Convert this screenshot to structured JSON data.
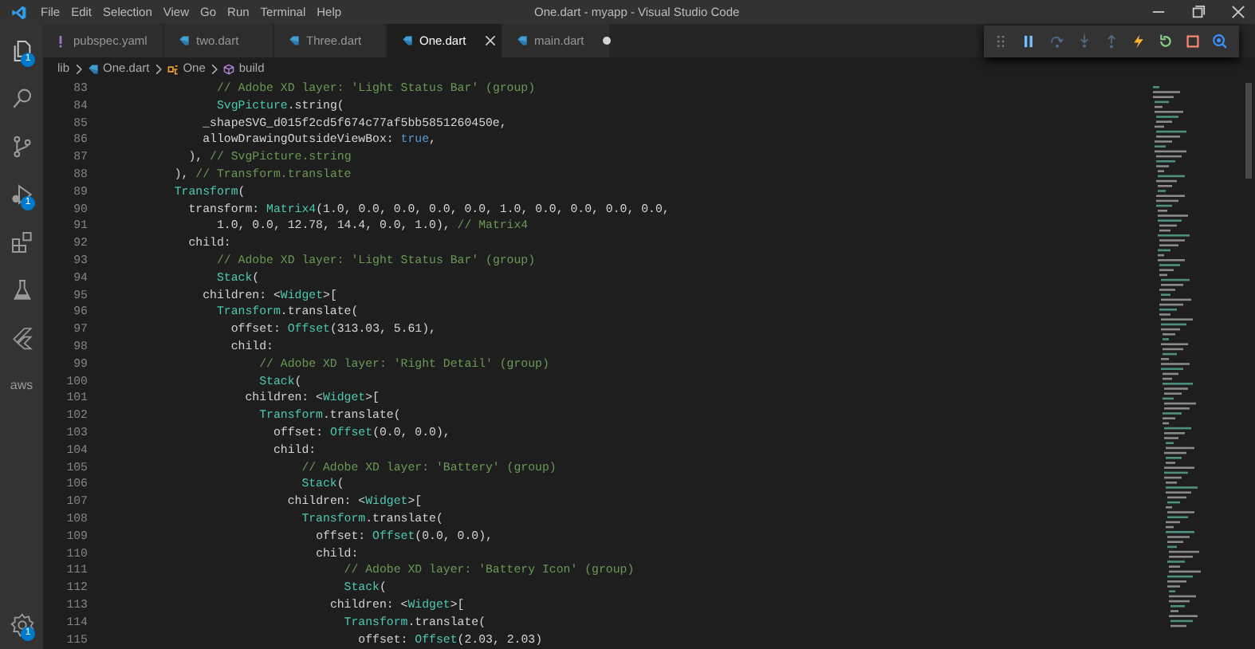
{
  "title_bar": {
    "menu": [
      "File",
      "Edit",
      "Selection",
      "View",
      "Go",
      "Run",
      "Terminal",
      "Help"
    ],
    "title": "One.dart - myapp - Visual Studio Code"
  },
  "activity_bar": {
    "items": [
      {
        "kind": "explorer",
        "badge": "1"
      },
      {
        "kind": "search"
      },
      {
        "kind": "source-control"
      },
      {
        "kind": "run-debug",
        "badge": "1"
      },
      {
        "kind": "extensions"
      },
      {
        "kind": "testing"
      },
      {
        "kind": "flutter"
      },
      {
        "kind": "aws",
        "label": "aws"
      }
    ],
    "bottom": {
      "kind": "settings",
      "badge": "1"
    }
  },
  "tabs": [
    {
      "label": "pubspec.yaml",
      "kind": "yaml",
      "selected": false,
      "modified": false
    },
    {
      "label": "two.dart",
      "kind": "dart",
      "selected": false,
      "modified": false
    },
    {
      "label": "Three.dart",
      "kind": "dart",
      "selected": false,
      "modified": false
    },
    {
      "label": "One.dart",
      "kind": "dart",
      "selected": true,
      "modified": false
    },
    {
      "label": "main.dart",
      "kind": "dart",
      "selected": false,
      "modified": true
    }
  ],
  "breadcrumbs": [
    {
      "kind": "folder",
      "label": "lib"
    },
    {
      "kind": "dart",
      "label": "One.dart"
    },
    {
      "kind": "class",
      "label": "One"
    },
    {
      "kind": "method",
      "label": "build"
    }
  ],
  "debug_toolbar": [
    {
      "kind": "grip"
    },
    {
      "kind": "pause"
    },
    {
      "kind": "step-over"
    },
    {
      "kind": "step-into"
    },
    {
      "kind": "step-out"
    },
    {
      "kind": "hot-reload"
    },
    {
      "kind": "restart"
    },
    {
      "kind": "stop"
    },
    {
      "kind": "devtools"
    }
  ],
  "editor": {
    "lines": [
      {
        "number": "83",
        "segments": [
          {
            "kind": "comment",
            "text": "                // Adobe XD layer: 'Light Status Bar' (group)"
          }
        ]
      },
      {
        "number": "84",
        "segments": [
          {
            "kind": "type",
            "text": "                SvgPicture"
          },
          {
            "kind": "plain",
            "text": ".string("
          }
        ]
      },
      {
        "number": "85",
        "segments": [
          {
            "kind": "plain",
            "text": "              _shapeSVG_d015f2cd5f674c77af5bb5851260450e,"
          }
        ]
      },
      {
        "number": "86",
        "segments": [
          {
            "kind": "plain",
            "text": "              allowDrawingOutsideViewBox: "
          },
          {
            "kind": "keyword",
            "text": "true"
          },
          {
            "kind": "plain",
            "text": ","
          }
        ]
      },
      {
        "number": "87",
        "segments": [
          {
            "kind": "plain",
            "text": "            ), "
          },
          {
            "kind": "comment",
            "text": "// SvgPicture.string"
          }
        ]
      },
      {
        "number": "88",
        "segments": [
          {
            "kind": "plain",
            "text": "          ), "
          },
          {
            "kind": "comment",
            "text": "// Transform.translate"
          }
        ]
      },
      {
        "number": "89",
        "segments": [
          {
            "kind": "type",
            "text": "          Transform"
          },
          {
            "kind": "plain",
            "text": "("
          }
        ]
      },
      {
        "number": "90",
        "segments": [
          {
            "kind": "plain",
            "text": "            transform: "
          },
          {
            "kind": "type",
            "text": "Matrix4"
          },
          {
            "kind": "plain",
            "text": "(1.0, 0.0, 0.0, 0.0, 0.0, 1.0, 0.0, 0.0, 0.0, 0.0,"
          }
        ]
      },
      {
        "number": "91",
        "segments": [
          {
            "kind": "plain",
            "text": "                1.0, 0.0, 12.78, 14.4, 0.0, 1.0), "
          },
          {
            "kind": "comment",
            "text": "// Matrix4"
          }
        ]
      },
      {
        "number": "92",
        "segments": [
          {
            "kind": "plain",
            "text": "            child:"
          }
        ]
      },
      {
        "number": "93",
        "segments": [
          {
            "kind": "comment",
            "text": "                // Adobe XD layer: 'Light Status Bar' (group)"
          }
        ]
      },
      {
        "number": "94",
        "segments": [
          {
            "kind": "type",
            "text": "                Stack"
          },
          {
            "kind": "plain",
            "text": "("
          }
        ]
      },
      {
        "number": "95",
        "segments": [
          {
            "kind": "plain",
            "text": "              children: <"
          },
          {
            "kind": "type",
            "text": "Widget"
          },
          {
            "kind": "plain",
            "text": ">["
          }
        ]
      },
      {
        "number": "96",
        "segments": [
          {
            "kind": "type",
            "text": "                Transform"
          },
          {
            "kind": "plain",
            "text": ".translate("
          }
        ]
      },
      {
        "number": "97",
        "segments": [
          {
            "kind": "plain",
            "text": "                  offset: "
          },
          {
            "kind": "type",
            "text": "Offset"
          },
          {
            "kind": "plain",
            "text": "(313.03, 5.61),"
          }
        ]
      },
      {
        "number": "98",
        "segments": [
          {
            "kind": "plain",
            "text": "                  child:"
          }
        ]
      },
      {
        "number": "99",
        "segments": [
          {
            "kind": "comment",
            "text": "                      // Adobe XD layer: 'Right Detail' (group)"
          }
        ]
      },
      {
        "number": "100",
        "segments": [
          {
            "kind": "type",
            "text": "                      Stack"
          },
          {
            "kind": "plain",
            "text": "("
          }
        ]
      },
      {
        "number": "101",
        "segments": [
          {
            "kind": "plain",
            "text": "                    children: <"
          },
          {
            "kind": "type",
            "text": "Widget"
          },
          {
            "kind": "plain",
            "text": ">["
          }
        ]
      },
      {
        "number": "102",
        "segments": [
          {
            "kind": "type",
            "text": "                      Transform"
          },
          {
            "kind": "plain",
            "text": ".translate("
          }
        ]
      },
      {
        "number": "103",
        "segments": [
          {
            "kind": "plain",
            "text": "                        offset: "
          },
          {
            "kind": "type",
            "text": "Offset"
          },
          {
            "kind": "plain",
            "text": "(0.0, 0.0),"
          }
        ]
      },
      {
        "number": "104",
        "segments": [
          {
            "kind": "plain",
            "text": "                        child:"
          }
        ]
      },
      {
        "number": "105",
        "segments": [
          {
            "kind": "comment",
            "text": "                            // Adobe XD layer: 'Battery' (group)"
          }
        ]
      },
      {
        "number": "106",
        "segments": [
          {
            "kind": "type",
            "text": "                            Stack"
          },
          {
            "kind": "plain",
            "text": "("
          }
        ]
      },
      {
        "number": "107",
        "segments": [
          {
            "kind": "plain",
            "text": "                          children: <"
          },
          {
            "kind": "type",
            "text": "Widget"
          },
          {
            "kind": "plain",
            "text": ">["
          }
        ]
      },
      {
        "number": "108",
        "segments": [
          {
            "kind": "type",
            "text": "                            Transform"
          },
          {
            "kind": "plain",
            "text": ".translate("
          }
        ]
      },
      {
        "number": "109",
        "segments": [
          {
            "kind": "plain",
            "text": "                              offset: "
          },
          {
            "kind": "type",
            "text": "Offset"
          },
          {
            "kind": "plain",
            "text": "(0.0, 0.0),"
          }
        ]
      },
      {
        "number": "110",
        "segments": [
          {
            "kind": "plain",
            "text": "                              child:"
          }
        ]
      },
      {
        "number": "111",
        "segments": [
          {
            "kind": "comment",
            "text": "                                  // Adobe XD layer: 'Battery Icon' (group)"
          }
        ]
      },
      {
        "number": "112",
        "segments": [
          {
            "kind": "type",
            "text": "                                  Stack"
          },
          {
            "kind": "plain",
            "text": "("
          }
        ]
      },
      {
        "number": "113",
        "segments": [
          {
            "kind": "plain",
            "text": "                                children: <"
          },
          {
            "kind": "type",
            "text": "Widget"
          },
          {
            "kind": "plain",
            "text": ">["
          }
        ]
      },
      {
        "number": "114",
        "segments": [
          {
            "kind": "type",
            "text": "                                  Transform"
          },
          {
            "kind": "plain",
            "text": ".translate("
          }
        ]
      },
      {
        "number": "115",
        "segments": [
          {
            "kind": "plain",
            "text": "                                    offset: "
          },
          {
            "kind": "type",
            "text": "Offset"
          },
          {
            "kind": "plain",
            "text": "(2.03, 2.03)"
          }
        ]
      }
    ]
  }
}
